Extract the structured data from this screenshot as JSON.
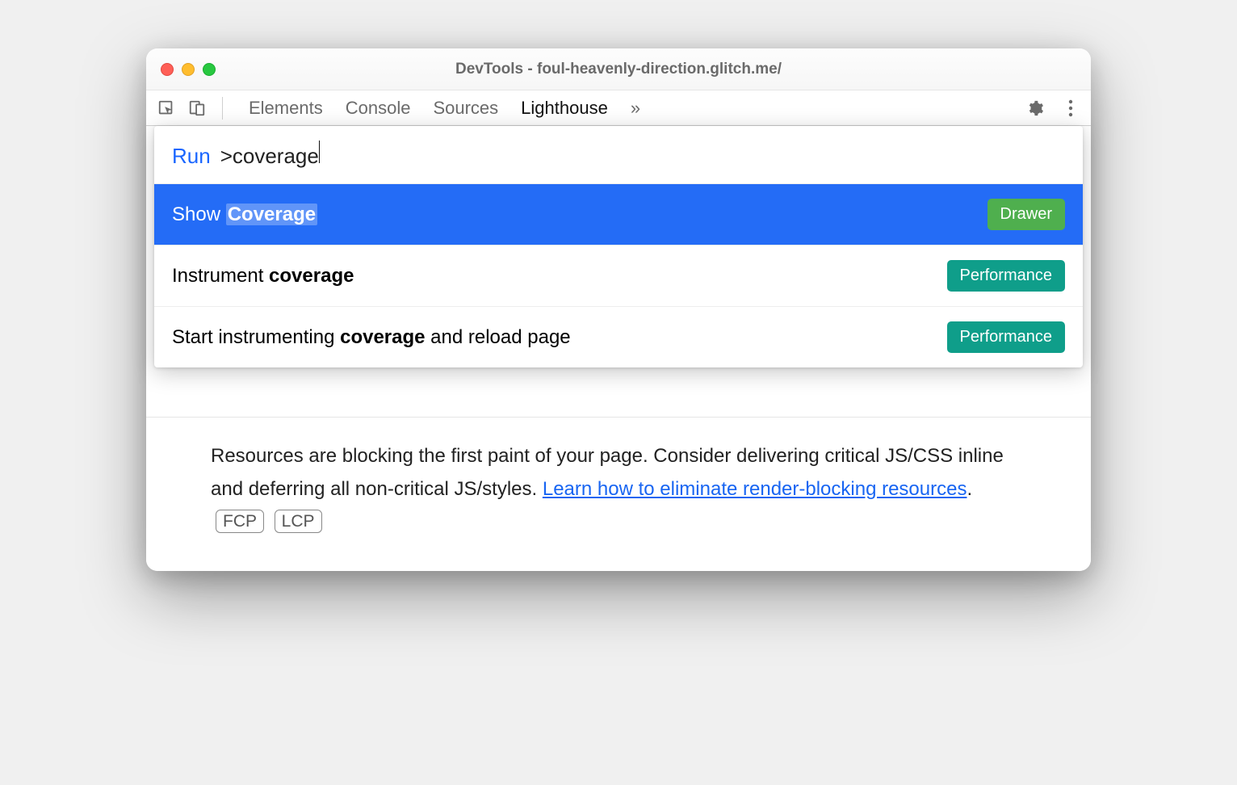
{
  "window": {
    "title": "DevTools - foul-heavenly-direction.glitch.me/"
  },
  "toolbar": {
    "tabs": [
      "Elements",
      "Console",
      "Sources",
      "Lighthouse"
    ],
    "activeTab": "Lighthouse",
    "overflowGlyph": "»"
  },
  "commandMenu": {
    "prefix": "Run",
    "gt": ">",
    "query": "coverage",
    "items": [
      {
        "beforeMatch": "Show ",
        "match": "Coverage",
        "afterMatch": "",
        "badgeLabel": "Drawer",
        "badgeKind": "drawer",
        "selected": true
      },
      {
        "beforeMatch": "Instrument ",
        "match": "coverage",
        "afterMatch": "",
        "badgeLabel": "Performance",
        "badgeKind": "perf",
        "selected": false
      },
      {
        "beforeMatch": "Start instrumenting ",
        "match": "coverage",
        "afterMatch": " and reload page",
        "badgeLabel": "Performance",
        "badgeKind": "perf",
        "selected": false
      }
    ]
  },
  "description": {
    "textBefore": "Resources are blocking the first paint of your page. Consider delivering critical JS/CSS inline and deferring all non-critical JS/styles. ",
    "linkText": "Learn how to eliminate render-blocking resources",
    "period": ".",
    "metrics": [
      "FCP",
      "LCP"
    ]
  }
}
